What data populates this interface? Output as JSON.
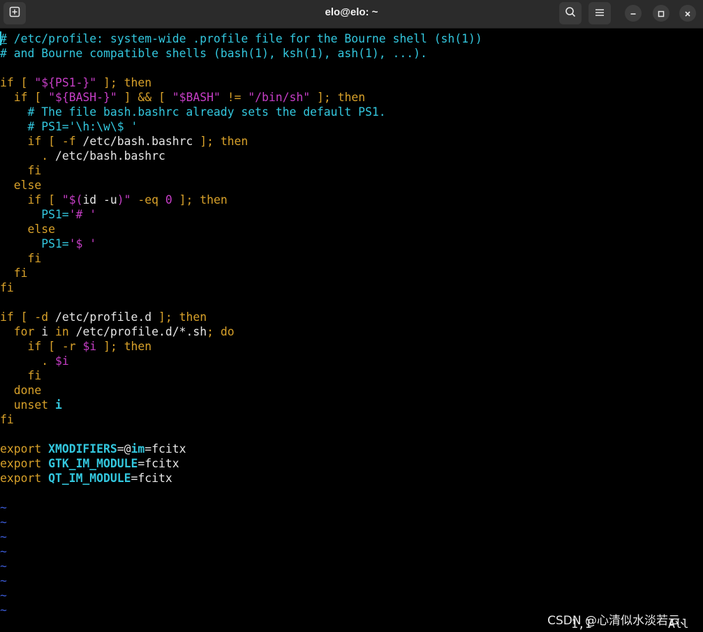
{
  "window": {
    "title": "elo@elo: ~",
    "buttons": {
      "new_tab_icon": "new-tab-icon",
      "search_icon": "search-icon",
      "menu_icon": "hamburger-icon",
      "minimize_icon": "minimize-icon",
      "maximize_icon": "maximize-icon",
      "close_icon": "close-icon"
    }
  },
  "editor": {
    "lines": [
      {
        "segments": [
          {
            "t": "#",
            "cls": "c"
          },
          {
            "t": " /etc/profile: system-wide .profile file for the Bourne shell (sh(1))",
            "cls": "c"
          }
        ]
      },
      {
        "segments": [
          {
            "t": "# and Bourne compatible shells (bash(1), ksh(1), ash(1), ...).",
            "cls": "c"
          }
        ]
      },
      {
        "segments": [
          {
            "t": "",
            "cls": ""
          }
        ]
      },
      {
        "segments": [
          {
            "t": "if",
            "cls": "k"
          },
          {
            "t": " [ ",
            "cls": "k"
          },
          {
            "t": "\"${PS1-}\"",
            "cls": "s"
          },
          {
            "t": " ]; ",
            "cls": "k"
          },
          {
            "t": "then",
            "cls": "k"
          }
        ]
      },
      {
        "segments": [
          {
            "t": "  if",
            "cls": "k"
          },
          {
            "t": " [ ",
            "cls": "k"
          },
          {
            "t": "\"${BASH-}\"",
            "cls": "s"
          },
          {
            "t": " ] && [ ",
            "cls": "k"
          },
          {
            "t": "\"$BASH\"",
            "cls": "s"
          },
          {
            "t": " != ",
            "cls": "k"
          },
          {
            "t": "\"/bin/sh\"",
            "cls": "s"
          },
          {
            "t": " ]; ",
            "cls": "k"
          },
          {
            "t": "then",
            "cls": "k"
          }
        ]
      },
      {
        "segments": [
          {
            "t": "    # The file bash.bashrc already sets the default PS1.",
            "cls": "c"
          }
        ]
      },
      {
        "segments": [
          {
            "t": "    # PS1='\\h:\\w\\$ '",
            "cls": "c"
          }
        ]
      },
      {
        "segments": [
          {
            "t": "    if",
            "cls": "k"
          },
          {
            "t": " [ ",
            "cls": "k"
          },
          {
            "t": "-f",
            "cls": "k"
          },
          {
            "t": " /etc/bash.bashrc ",
            "cls": ""
          },
          {
            "t": "]; ",
            "cls": "k"
          },
          {
            "t": "then",
            "cls": "k"
          }
        ]
      },
      {
        "segments": [
          {
            "t": "      .",
            "cls": "k"
          },
          {
            "t": " /etc/bash.bashrc",
            "cls": ""
          }
        ]
      },
      {
        "segments": [
          {
            "t": "    fi",
            "cls": "k"
          }
        ]
      },
      {
        "segments": [
          {
            "t": "  else",
            "cls": "k"
          }
        ]
      },
      {
        "segments": [
          {
            "t": "    if",
            "cls": "k"
          },
          {
            "t": " [ ",
            "cls": "k"
          },
          {
            "t": "\"$(",
            "cls": "s"
          },
          {
            "t": "id -u",
            "cls": ""
          },
          {
            "t": ")\"",
            "cls": "s"
          },
          {
            "t": " -eq ",
            "cls": "k"
          },
          {
            "t": "0",
            "cls": "s"
          },
          {
            "t": " ]; ",
            "cls": "k"
          },
          {
            "t": "then",
            "cls": "k"
          }
        ]
      },
      {
        "segments": [
          {
            "t": "      PS1=",
            "cls": "c"
          },
          {
            "t": "'# '",
            "cls": "s"
          }
        ]
      },
      {
        "segments": [
          {
            "t": "    else",
            "cls": "k"
          }
        ]
      },
      {
        "segments": [
          {
            "t": "      PS1=",
            "cls": "c"
          },
          {
            "t": "'$ '",
            "cls": "s"
          }
        ]
      },
      {
        "segments": [
          {
            "t": "    fi",
            "cls": "k"
          }
        ]
      },
      {
        "segments": [
          {
            "t": "  fi",
            "cls": "k"
          }
        ]
      },
      {
        "segments": [
          {
            "t": "fi",
            "cls": "k"
          }
        ]
      },
      {
        "segments": [
          {
            "t": "",
            "cls": ""
          }
        ]
      },
      {
        "segments": [
          {
            "t": "if",
            "cls": "k"
          },
          {
            "t": " [ ",
            "cls": "k"
          },
          {
            "t": "-d",
            "cls": "k"
          },
          {
            "t": " /etc/profile.d ",
            "cls": ""
          },
          {
            "t": "]; ",
            "cls": "k"
          },
          {
            "t": "then",
            "cls": "k"
          }
        ]
      },
      {
        "segments": [
          {
            "t": "  for",
            "cls": "k"
          },
          {
            "t": " i ",
            "cls": ""
          },
          {
            "t": "in",
            "cls": "k"
          },
          {
            "t": " /etc/profile.d/*.sh",
            "cls": ""
          },
          {
            "t": "; ",
            "cls": "k"
          },
          {
            "t": "do",
            "cls": "k"
          }
        ]
      },
      {
        "segments": [
          {
            "t": "    if",
            "cls": "k"
          },
          {
            "t": " [ ",
            "cls": "k"
          },
          {
            "t": "-r",
            "cls": "k"
          },
          {
            "t": " ",
            "cls": ""
          },
          {
            "t": "$i",
            "cls": "s"
          },
          {
            "t": " ]; ",
            "cls": "k"
          },
          {
            "t": "then",
            "cls": "k"
          }
        ]
      },
      {
        "segments": [
          {
            "t": "      .",
            "cls": "k"
          },
          {
            "t": " ",
            "cls": ""
          },
          {
            "t": "$i",
            "cls": "s"
          }
        ]
      },
      {
        "segments": [
          {
            "t": "    fi",
            "cls": "k"
          }
        ]
      },
      {
        "segments": [
          {
            "t": "  done",
            "cls": "k"
          }
        ]
      },
      {
        "segments": [
          {
            "t": "  unset",
            "cls": "k"
          },
          {
            "t": " ",
            "cls": ""
          },
          {
            "t": "i",
            "cls": "id"
          }
        ]
      },
      {
        "segments": [
          {
            "t": "fi",
            "cls": "k"
          }
        ]
      },
      {
        "segments": [
          {
            "t": "",
            "cls": ""
          }
        ]
      },
      {
        "segments": [
          {
            "t": "export",
            "cls": "k"
          },
          {
            "t": " ",
            "cls": ""
          },
          {
            "t": "XMODIFIERS",
            "cls": "id"
          },
          {
            "t": "=@",
            "cls": ""
          },
          {
            "t": "im",
            "cls": "id"
          },
          {
            "t": "=fcitx",
            "cls": ""
          }
        ]
      },
      {
        "segments": [
          {
            "t": "export",
            "cls": "k"
          },
          {
            "t": " ",
            "cls": ""
          },
          {
            "t": "GTK_IM_MODULE",
            "cls": "id"
          },
          {
            "t": "=fcitx",
            "cls": ""
          }
        ]
      },
      {
        "segments": [
          {
            "t": "export",
            "cls": "k"
          },
          {
            "t": " ",
            "cls": ""
          },
          {
            "t": "QT_IM_MODULE",
            "cls": "id"
          },
          {
            "t": "=fcitx",
            "cls": ""
          }
        ]
      },
      {
        "segments": [
          {
            "t": "",
            "cls": ""
          }
        ]
      },
      {
        "segments": [
          {
            "t": "~",
            "cls": "tilde"
          }
        ]
      },
      {
        "segments": [
          {
            "t": "~",
            "cls": "tilde"
          }
        ]
      },
      {
        "segments": [
          {
            "t": "~",
            "cls": "tilde"
          }
        ]
      },
      {
        "segments": [
          {
            "t": "~",
            "cls": "tilde"
          }
        ]
      },
      {
        "segments": [
          {
            "t": "~",
            "cls": "tilde"
          }
        ]
      },
      {
        "segments": [
          {
            "t": "~",
            "cls": "tilde"
          }
        ]
      },
      {
        "segments": [
          {
            "t": "~",
            "cls": "tilde"
          }
        ]
      },
      {
        "segments": [
          {
            "t": "~",
            "cls": "tilde"
          }
        ]
      }
    ],
    "status_position": "1,1",
    "status_scroll": "All"
  },
  "watermark": "CSDN @心清似水淡若云、",
  "colors": {
    "background": "#000000",
    "comment": "#33c7de",
    "keyword": "#d8a12a",
    "string": "#c63ec6",
    "tilde": "#3b5bd6",
    "titlebar": "#2b2b2b"
  }
}
